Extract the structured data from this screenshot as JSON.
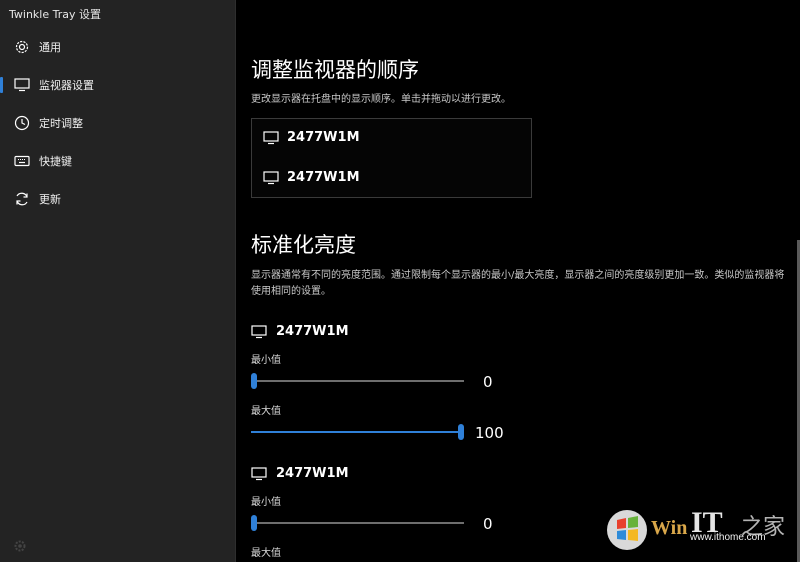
{
  "window": {
    "title": "Twinkle Tray 设置"
  },
  "sidebar": {
    "items": [
      {
        "label": "通用",
        "icon": "gear-icon",
        "active": false
      },
      {
        "label": "监视器设置",
        "icon": "monitor-icon",
        "active": true
      },
      {
        "label": "定时调整",
        "icon": "clock-icon",
        "active": false
      },
      {
        "label": "快捷键",
        "icon": "keyboard-icon",
        "active": false
      },
      {
        "label": "更新",
        "icon": "refresh-icon",
        "active": false
      }
    ]
  },
  "main": {
    "order": {
      "title": "调整监视器的顺序",
      "description": "更改显示器在托盘中的显示顺序。单击并拖动以进行更改。",
      "monitors": [
        "2477W1M",
        "2477W1M"
      ]
    },
    "normalize": {
      "title": "标准化亮度",
      "description": "显示器通常有不同的亮度范围。通过限制每个显示器的最小/最大亮度，显示器之间的亮度级别更加一致。类似的监视器将使用相同的设置。",
      "monitors": [
        {
          "name": "2477W1M",
          "min_label": "最小值",
          "min_value": 0,
          "max_label": "最大值",
          "max_value": 100
        },
        {
          "name": "2477W1M",
          "min_label": "最小值",
          "min_value": 0,
          "max_label": "最大值"
        }
      ]
    }
  },
  "watermark": {
    "site": "www.ithome.com"
  },
  "colors": {
    "accent": "#2f80d8",
    "sidebar_bg": "#232323",
    "main_bg": "#000000"
  }
}
